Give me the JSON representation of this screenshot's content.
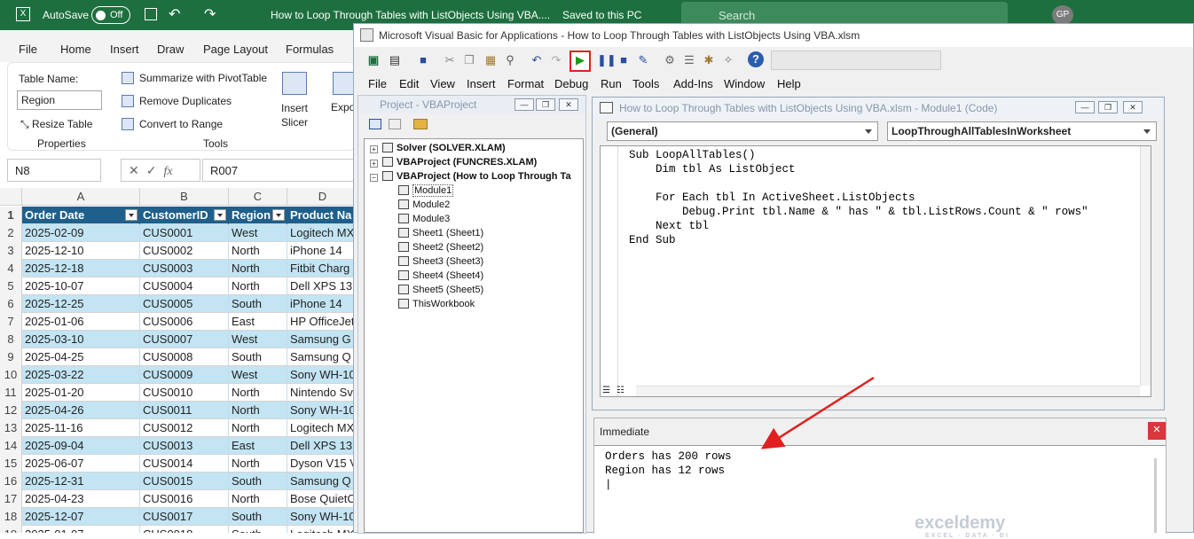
{
  "excel": {
    "autosave_label": "AutoSave",
    "autosave_state": "Off",
    "title": "How to Loop Through Tables with ListObjects Using VBA....",
    "saved_status": "Saved to this PC",
    "search_placeholder": "Search",
    "user_initials": "GP",
    "menu": [
      "File",
      "Home",
      "Insert",
      "Draw",
      "Page Layout",
      "Formulas"
    ],
    "ribbon": {
      "table_name_label": "Table Name:",
      "table_name_value": "Region",
      "resize_table": "Resize Table",
      "properties_group": "Properties",
      "summarize_pivot": "Summarize with PivotTable",
      "remove_duplicates": "Remove Duplicates",
      "convert_to_range": "Convert to Range",
      "tools_group": "Tools",
      "insert_slicer_1": "Insert",
      "insert_slicer_2": "Slicer",
      "export_label": "Expo"
    },
    "name_box": "N8",
    "fx": "fx",
    "formula_value": "R007",
    "columns": [
      "A",
      "B",
      "C",
      "D"
    ],
    "headers": [
      "Order Date",
      "CustomerID",
      "Region",
      "Product Na"
    ],
    "rows": [
      [
        "1",
        "",
        "",
        "",
        ""
      ],
      [
        "2",
        "2025-02-09",
        "CUS0001",
        "West",
        "Logitech MX"
      ],
      [
        "3",
        "2025-12-10",
        "CUS0002",
        "North",
        "iPhone 14"
      ],
      [
        "4",
        "2025-12-18",
        "CUS0003",
        "North",
        "Fitbit Charg"
      ],
      [
        "5",
        "2025-10-07",
        "CUS0004",
        "North",
        "Dell XPS 13"
      ],
      [
        "6",
        "2025-12-25",
        "CUS0005",
        "South",
        "iPhone 14"
      ],
      [
        "7",
        "2025-01-06",
        "CUS0006",
        "East",
        "HP OfficeJet"
      ],
      [
        "8",
        "2025-03-10",
        "CUS0007",
        "West",
        "Samsung G"
      ],
      [
        "9",
        "2025-04-25",
        "CUS0008",
        "South",
        "Samsung Q"
      ],
      [
        "10",
        "2025-03-22",
        "CUS0009",
        "West",
        "Sony WH-10"
      ],
      [
        "11",
        "2025-01-20",
        "CUS0010",
        "North",
        "Nintendo Sv"
      ],
      [
        "12",
        "2025-04-26",
        "CUS0011",
        "North",
        "Sony WH-10"
      ],
      [
        "13",
        "2025-11-16",
        "CUS0012",
        "North",
        "Logitech MX"
      ],
      [
        "14",
        "2025-09-04",
        "CUS0013",
        "East",
        "Dell XPS 13"
      ],
      [
        "15",
        "2025-06-07",
        "CUS0014",
        "North",
        "Dyson V15 V"
      ],
      [
        "16",
        "2025-12-31",
        "CUS0015",
        "South",
        "Samsung Q"
      ],
      [
        "17",
        "2025-04-23",
        "CUS0016",
        "North",
        "Bose QuietC"
      ],
      [
        "18",
        "2025-12-07",
        "CUS0017",
        "South",
        "Sony WH-10"
      ],
      [
        "19",
        "2025-01-07",
        "CUS0018",
        "South",
        "Logitech MX"
      ]
    ]
  },
  "vba": {
    "title": "Microsoft Visual Basic for Applications - How to Loop Through Tables with ListObjects Using VBA.xlsm",
    "menu": [
      "File",
      "Edit",
      "View",
      "Insert",
      "Format",
      "Debug",
      "Run",
      "Tools",
      "Add-Ins",
      "Window",
      "Help"
    ],
    "project_title": "Project - VBAProject",
    "tree": [
      {
        "label": "Solver (SOLVER.XLAM)",
        "bold": true,
        "level": 0
      },
      {
        "label": "VBAProject (FUNCRES.XLAM)",
        "bold": true,
        "level": 0
      },
      {
        "label": "VBAProject (How to Loop Through Ta",
        "bold": true,
        "level": 0
      },
      {
        "label": "Module1",
        "bold": false,
        "level": 1
      },
      {
        "label": "Module2",
        "bold": false,
        "level": 1
      },
      {
        "label": "Module3",
        "bold": false,
        "level": 1
      },
      {
        "label": "Sheet1 (Sheet1)",
        "bold": false,
        "level": 1
      },
      {
        "label": "Sheet2 (Sheet2)",
        "bold": false,
        "level": 1
      },
      {
        "label": "Sheet3 (Sheet3)",
        "bold": false,
        "level": 1
      },
      {
        "label": "Sheet4 (Sheet4)",
        "bold": false,
        "level": 1
      },
      {
        "label": "Sheet5 (Sheet5)",
        "bold": false,
        "level": 1
      },
      {
        "label": "ThisWorkbook",
        "bold": false,
        "level": 1
      }
    ],
    "code_title": "How to Loop Through Tables with ListObjects Using VBA.xlsm - Module1 (Code)",
    "object_combo": "(General)",
    "proc_combo": "LoopThroughAllTablesInWorksheet",
    "code": "Sub LoopAllTables()\n    Dim tbl As ListObject\n\n    For Each tbl In ActiveSheet.ListObjects\n        Debug.Print tbl.Name & \" has \" & tbl.ListRows.Count & \" rows\"\n    Next tbl\nEnd Sub",
    "immediate_title": "Immediate",
    "immediate_output": "Orders has 200 rows\nRegion has 12 rows\n|"
  },
  "watermark": {
    "name": "exceldemy",
    "tagline": "EXCEL · DATA · BI"
  },
  "colors": {
    "excel_green": "#1e6f3f",
    "table_header": "#1f5f8b",
    "band": "#c2e4f3",
    "run_highlight": "#e02020",
    "arrow": "#e02020"
  }
}
